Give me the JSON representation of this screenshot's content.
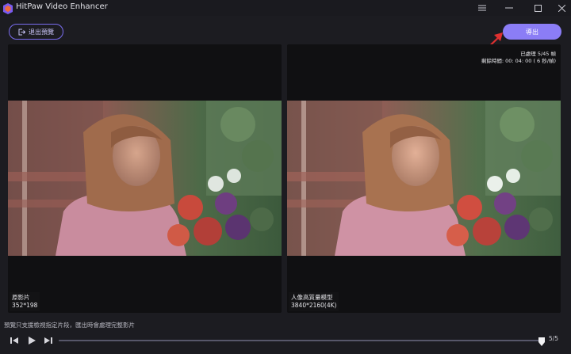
{
  "window": {
    "title": "HitPaw Video Enhancer"
  },
  "toolbar": {
    "exit_preview_label": "退出預覽",
    "export_label": "導出"
  },
  "preview": {
    "left": {
      "name": "原影片",
      "resolution": "352*198"
    },
    "right": {
      "name": "人像高質量模型",
      "resolution": "3840*2160(4K)",
      "processed": "已處理 5/45 幀",
      "remaining_time": "剩餘時間: 00: 04: 00 ( 6 秒/幀)"
    }
  },
  "footer": {
    "note": "預覽只支援檢視指定片段，匯出時會處理完整影片",
    "frame_counter": "5/5",
    "timeline_progress": 0.995
  },
  "colors": {
    "accent": "#8b7df6",
    "annotation_arrow": "#e03030"
  },
  "icons": [
    "app-logo-icon",
    "minimize-icon",
    "maximize-icon",
    "close-icon",
    "exit-icon",
    "prev-frame-icon",
    "play-icon",
    "next-frame-icon",
    "playhead-icon"
  ]
}
